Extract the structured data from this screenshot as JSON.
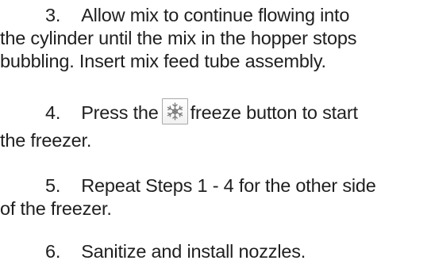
{
  "steps": [
    {
      "number": "3.",
      "lines": [
        "Allow mix to continue flowing into",
        "the cylinder until the mix in the hopper stops",
        "bubbling. Insert mix feed tube assembly."
      ]
    },
    {
      "number": "4.",
      "text_before_icon": "Press the",
      "icon": "snowflake-icon",
      "text_after_icon": "freeze button to start",
      "continuation": "the freezer."
    },
    {
      "number": "5.",
      "lines": [
        "Repeat Steps 1 - 4 for the other side",
        "of the freezer."
      ]
    },
    {
      "number": "6.",
      "lines": [
        "Sanitize and install nozzles."
      ]
    }
  ],
  "colors": {
    "text": "#1f1f1f",
    "icon_border": "#a9a9a9",
    "icon_stroke": "#7a7a7a"
  }
}
